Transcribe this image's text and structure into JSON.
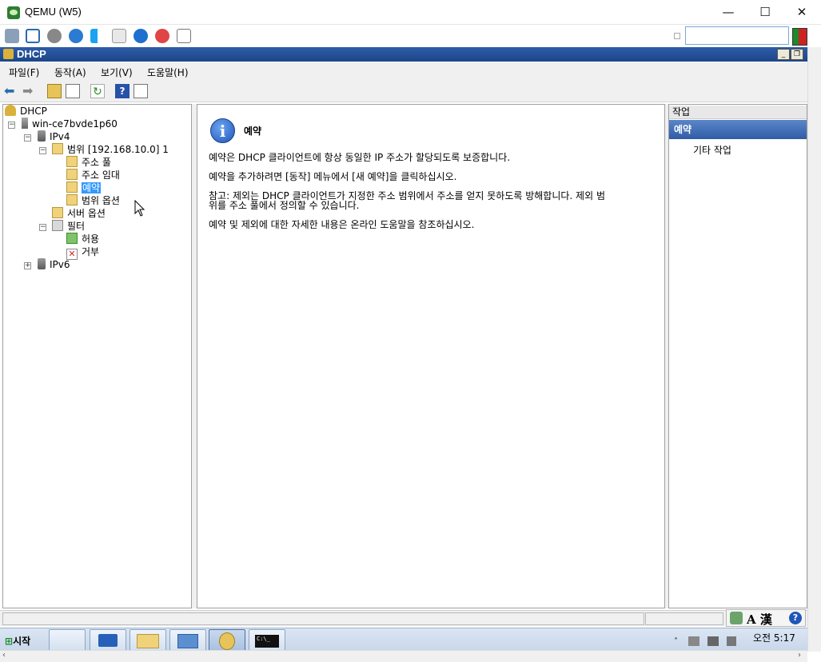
{
  "qemu": {
    "title": "QEMU (W5)",
    "controls": {
      "minimize": "—",
      "maximize": "☐",
      "close": "✕"
    },
    "search_value": ""
  },
  "mmc": {
    "title": "DHCP",
    "menu": [
      "파일(F)",
      "동작(A)",
      "보기(V)",
      "도움말(H)"
    ]
  },
  "tree": {
    "root": "DHCP",
    "server": "win-ce7bvde1p60",
    "ipv4": "IPv4",
    "scope": "범위 [192.168.10.0] 1",
    "address_pool": "주소 풀",
    "address_leases": "주소 임대",
    "reservations": "예약",
    "scope_options": "범위 옵션",
    "server_options": "서버 옵션",
    "filters": "필터",
    "allow": "허용",
    "deny": "거부",
    "ipv6": "IPv6"
  },
  "content": {
    "title": "예약",
    "p1": "예약은 DHCP 클라이언트에 항상 동일한 IP 주소가 할당되도록 보증합니다.",
    "p2": "예약을 추가하려면 [동작] 메뉴에서 [새 예약]을 클릭하십시오.",
    "p3_line1": "참고: 제외는 DHCP 클라이언트가 지정한 주소 범위에서 주소를 얻지 못하도록 방해합니다. 제외 범",
    "p3_line2": "위를 주소 풀에서 정의할 수 있습니다.",
    "p4": "예약 및 제외에 대한 자세한 내용은 온라인 도움말을 참조하십시오."
  },
  "actions": {
    "header": "작업",
    "section": "예약",
    "item": "기타 작업"
  },
  "taskbar": {
    "start": "시작",
    "ime": "A 漢",
    "clock": "오전 5:17"
  },
  "colors": {
    "title_blue": "#1d4689",
    "selection": "#3399ff",
    "actions_header": "#2f5ca6"
  }
}
